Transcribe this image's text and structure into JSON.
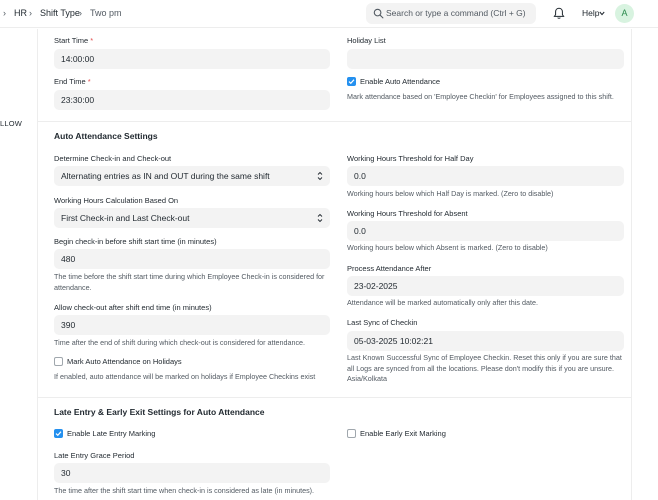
{
  "navbar": {
    "breadcrumb": [
      {
        "label": "HR"
      },
      {
        "label": "Shift Type"
      },
      {
        "label": "Two pm"
      }
    ],
    "search_placeholder": "Search or type a command (Ctrl + G)",
    "help_label": "Help",
    "avatar_initial": "A"
  },
  "sidebar": {
    "partial_label": "LLOW"
  },
  "timing": {
    "start_time_label": "Start Time",
    "start_time_value": "14:00:00",
    "end_time_label": "End Time",
    "end_time_value": "23:30:00",
    "required_mark": "*",
    "holiday_list_label": "Holiday List",
    "holiday_list_value": "",
    "enable_auto_attendance_label": "Enable Auto Attendance",
    "enable_auto_attendance_checked": true,
    "enable_auto_attendance_desc": "Mark attendance based on 'Employee Checkin' for Employees assigned to this shift."
  },
  "auto_attendance": {
    "title": "Auto Attendance Settings",
    "determine_label": "Determine Check-in and Check-out",
    "determine_value": "Alternating entries as IN and OUT during the same shift",
    "calc_label": "Working Hours Calculation Based On",
    "calc_value": "First Check-in and Last Check-out",
    "begin_label": "Begin check-in before shift start time (in minutes)",
    "begin_value": "480",
    "begin_desc": "The time before the shift start time during which Employee Check-in is considered for attendance.",
    "allow_label": "Allow check-out after shift end time (in minutes)",
    "allow_value": "390",
    "allow_desc": "Time after the end of shift during which check-out is considered for attendance.",
    "holidays_label": "Mark Auto Attendance on Holidays",
    "holidays_checked": false,
    "holidays_desc": "If enabled, auto attendance will be marked on holidays if Employee Checkins exist",
    "half_day_label": "Working Hours Threshold for Half Day",
    "half_day_value": "0.0",
    "half_day_desc": "Working hours below which Half Day is marked. (Zero to disable)",
    "absent_label": "Working Hours Threshold for Absent",
    "absent_value": "0.0",
    "absent_desc": "Working hours below which Absent is marked. (Zero to disable)",
    "process_label": "Process Attendance After",
    "process_value": "23-02-2025",
    "process_desc": "Attendance will be marked automatically only after this date.",
    "last_sync_label": "Last Sync of Checkin",
    "last_sync_value": "05-03-2025 10:02:21",
    "last_sync_desc": "Last Known Successful Sync of Employee Checkin. Reset this only if you are sure that all Logs are synced from all the locations. Please don't modify this if you are unsure. Asia/Kolkata"
  },
  "late_entry": {
    "title": "Late Entry & Early Exit Settings for Auto Attendance",
    "late_entry_label": "Enable Late Entry Marking",
    "late_entry_checked": true,
    "early_exit_label": "Enable Early Exit Marking",
    "early_exit_checked": false,
    "grace_label": "Late Entry Grace Period",
    "grace_value": "30",
    "grace_desc": "The time after the shift start time when check-in is considered as late (in minutes)."
  },
  "colors": {
    "accent": "#2490ef",
    "required": "#e24c4c",
    "input_bg": "#f3f3f3",
    "avatar_bg": "#d8f3e0",
    "avatar_fg": "#2a8a4c"
  }
}
